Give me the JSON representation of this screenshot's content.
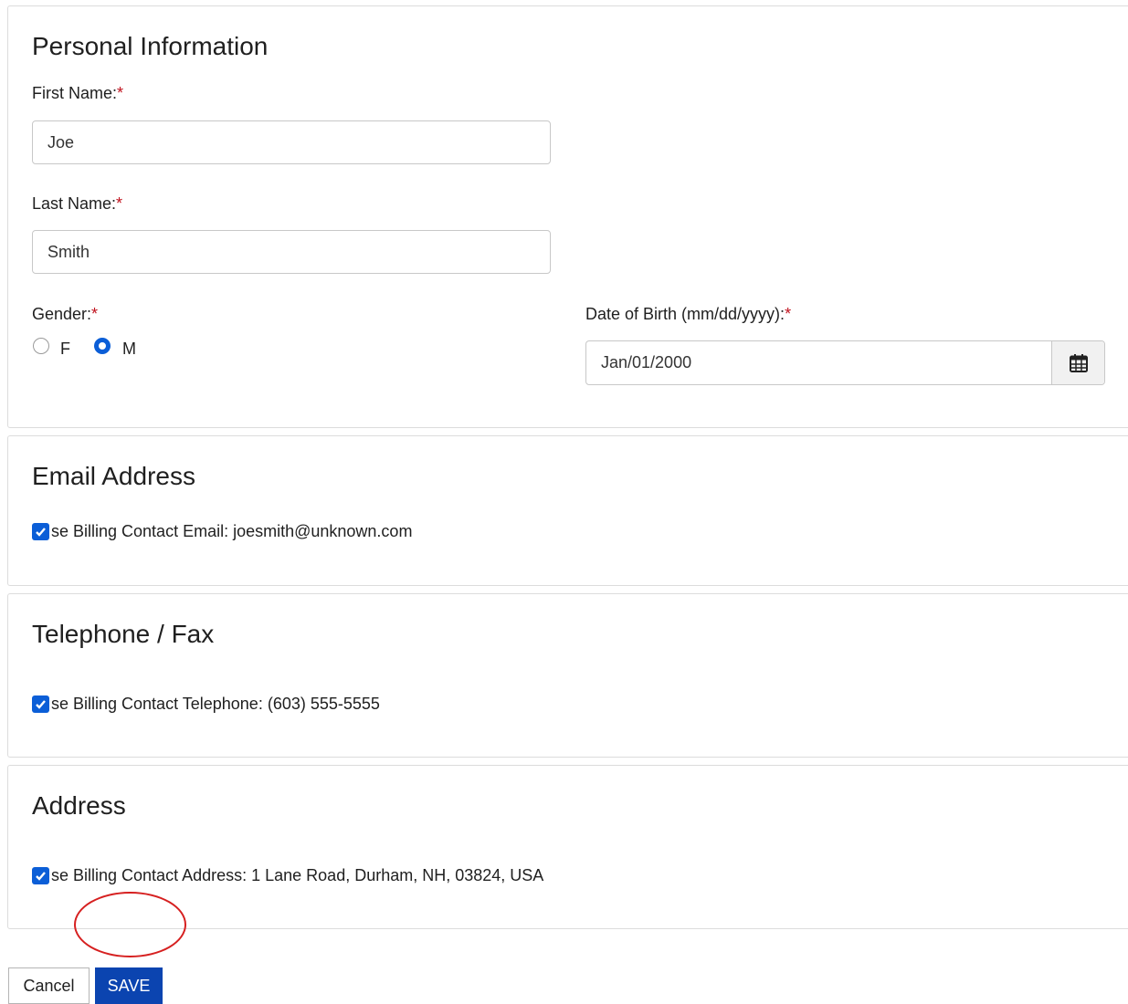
{
  "personal": {
    "title": "Personal Information",
    "first_name_label": "First Name:",
    "first_name_value": "Joe",
    "last_name_label": "Last Name:",
    "last_name_value": "Smith",
    "gender_label": "Gender:",
    "gender_options": [
      {
        "label": "F",
        "checked": false
      },
      {
        "label": "M",
        "checked": true
      }
    ],
    "dob_label": "Date of Birth (mm/dd/yyyy):",
    "dob_value": "Jan/01/2000",
    "required_mark": "*"
  },
  "email": {
    "title": "Email Address",
    "checkbox_label": "se Billing Contact Email: joesmith@unknown.com",
    "checked": true
  },
  "phone": {
    "title": "Telephone / Fax",
    "checkbox_label": "se Billing Contact Telephone: (603) 555-5555",
    "checked": true
  },
  "address": {
    "title": "Address",
    "checkbox_label": "se Billing Contact Address: 1 Lane Road, Durham, NH, 03824, USA",
    "checked": true
  },
  "actions": {
    "cancel_label": "Cancel",
    "save_label": "SAVE"
  },
  "colors": {
    "accent": "#0b5ed7",
    "save_button": "#0b44b0",
    "required": "#c0121e",
    "annotation": "#d62020"
  },
  "icons": {
    "calendar": "calendar-icon",
    "check": "checkmark-icon"
  }
}
